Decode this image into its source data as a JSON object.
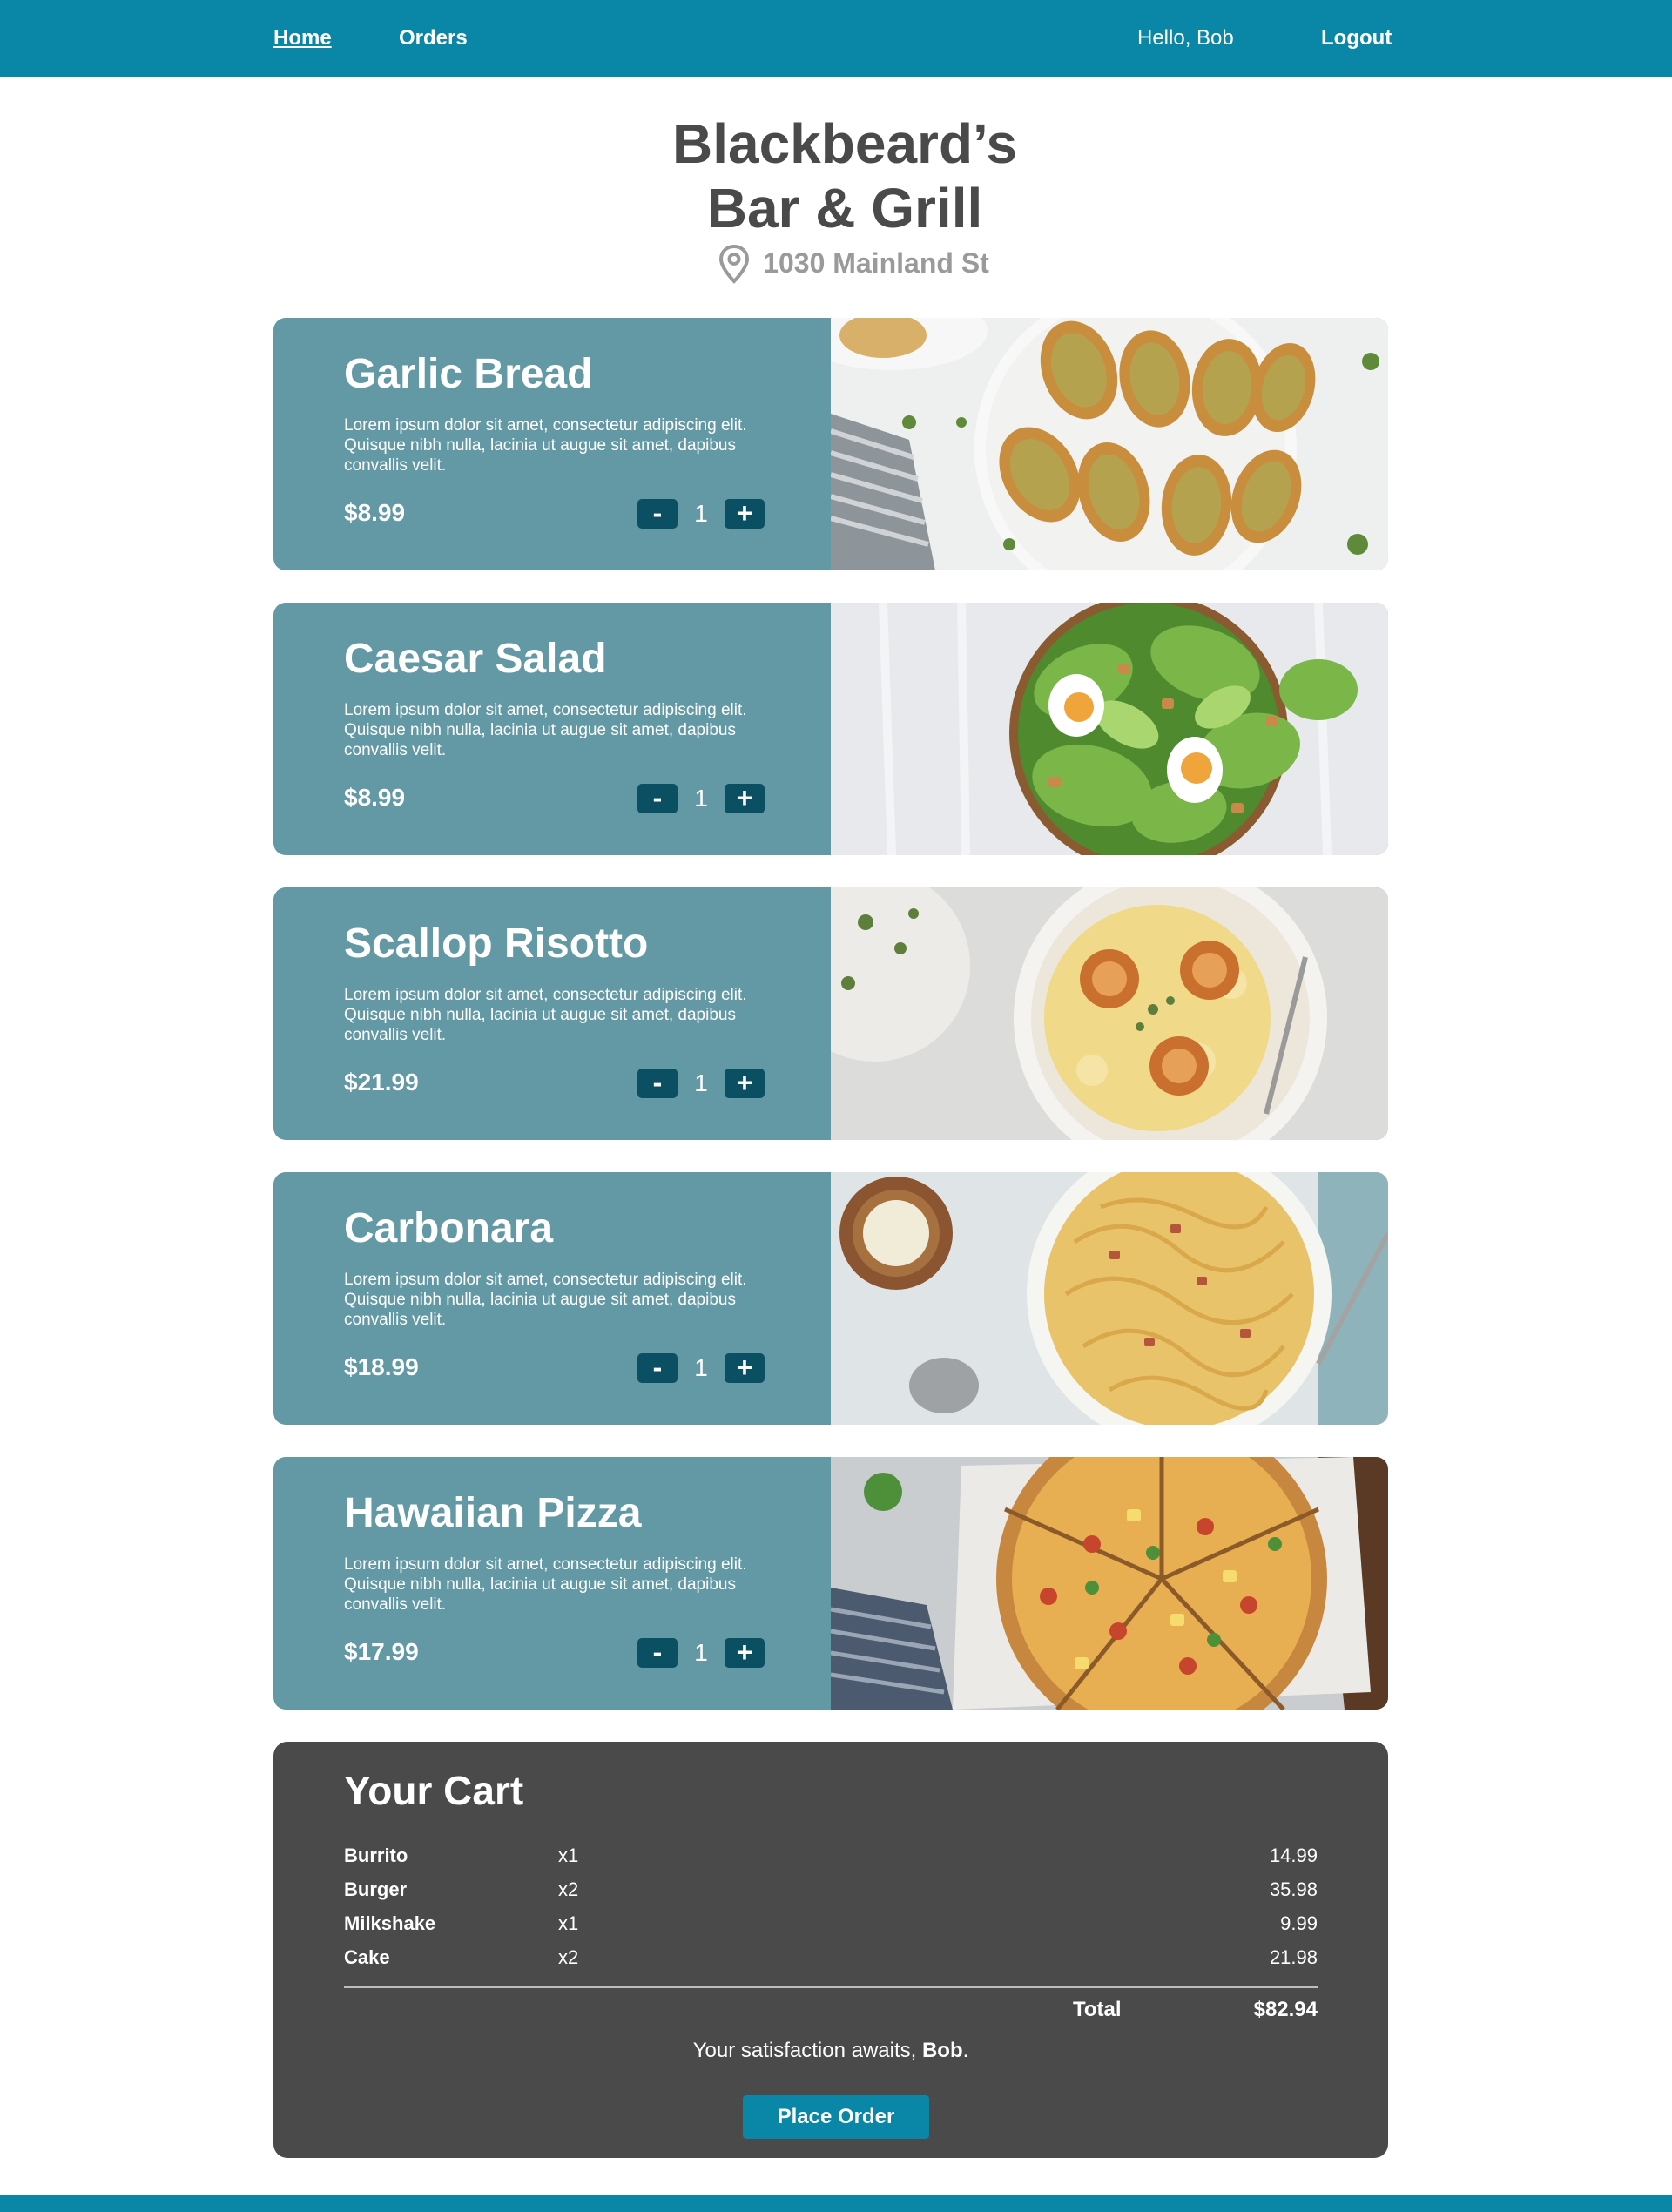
{
  "nav": {
    "home": "Home",
    "orders": "Orders",
    "greeting": "Hello, Bob",
    "logout": "Logout"
  },
  "restaurant": {
    "name_line1": "Blackbeard’s",
    "name_line2": "Bar & Grill",
    "address": "1030 Mainland St",
    "address_icon": "map-pin-icon"
  },
  "menu": {
    "items": [
      {
        "name": "Garlic Bread",
        "description": "Lorem ipsum dolor sit amet, consectetur adipiscing elit. Quisque nibh nulla, lacinia ut augue sit amet, dapibus convallis velit.",
        "price": "$8.99",
        "quantity": "1",
        "minus": "-",
        "plus": "+"
      },
      {
        "name": "Caesar Salad",
        "description": "Lorem ipsum dolor sit amet, consectetur adipiscing elit. Quisque nibh nulla, lacinia ut augue sit amet, dapibus convallis velit.",
        "price": "$8.99",
        "quantity": "1",
        "minus": "-",
        "plus": "+"
      },
      {
        "name": "Scallop Risotto",
        "description": "Lorem ipsum dolor sit amet, consectetur adipiscing elit. Quisque nibh nulla, lacinia ut augue sit amet, dapibus convallis velit.",
        "price": "$21.99",
        "quantity": "1",
        "minus": "-",
        "plus": "+"
      },
      {
        "name": "Carbonara",
        "description": "Lorem ipsum dolor sit amet, consectetur adipiscing elit. Quisque nibh nulla, lacinia ut augue sit amet, dapibus convallis velit.",
        "price": "$18.99",
        "quantity": "1",
        "minus": "-",
        "plus": "+"
      },
      {
        "name": "Hawaiian Pizza",
        "description": "Lorem ipsum dolor sit amet, consectetur adipiscing elit. Quisque nibh nulla, lacinia ut augue sit amet, dapibus convallis velit.",
        "price": "$17.99",
        "quantity": "1",
        "minus": "-",
        "plus": "+"
      }
    ]
  },
  "cart": {
    "title": "Your Cart",
    "items": [
      {
        "name": "Burrito",
        "qty": "x1",
        "price": "14.99"
      },
      {
        "name": "Burger",
        "qty": "x2",
        "price": "35.98"
      },
      {
        "name": "Milkshake",
        "qty": "x1",
        "price": "9.99"
      },
      {
        "name": "Cake",
        "qty": "x2",
        "price": "21.98"
      }
    ],
    "total_label": "Total",
    "total_value": "$82.94",
    "satisfaction_prefix": "Your satisfaction awaits, ",
    "satisfaction_name": "Bob",
    "satisfaction_suffix": ".",
    "place_order": "Place Order"
  },
  "colors": {
    "brand": "#0a86a6",
    "card": "#6399a5",
    "button_dark": "#0b4f63",
    "cart_bg": "#4a4a4a",
    "heading_text": "#4a4a4a"
  }
}
